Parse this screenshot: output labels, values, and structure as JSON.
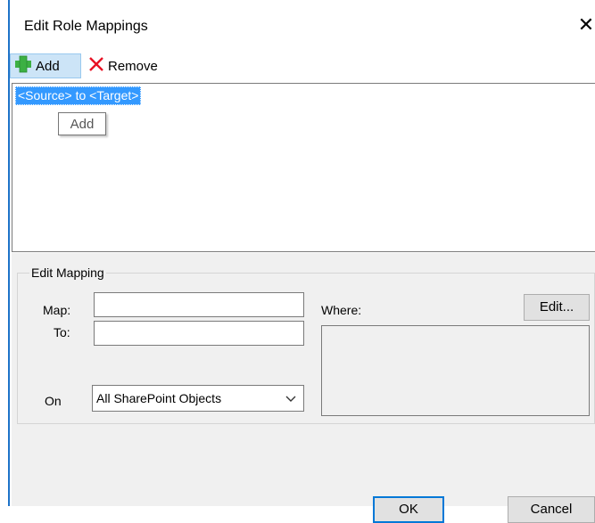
{
  "dialog": {
    "title": "Edit Role Mappings",
    "close_glyph": "✕"
  },
  "toolbar": {
    "add_label": "Add",
    "add_icon": "plus-icon",
    "remove_label": "Remove",
    "remove_icon": "x-icon"
  },
  "list": {
    "items": [
      {
        "label": "<Source> to <Target>",
        "selected": true
      }
    ]
  },
  "tooltip": {
    "text": "Add"
  },
  "edit_mapping": {
    "group_title": "Edit Mapping",
    "map_label": "Map:",
    "map_value": "",
    "to_label": "To:",
    "to_value": "",
    "on_label": "On",
    "on_selected": "All SharePoint Objects",
    "where_label": "Where:",
    "edit_button": "Edit..."
  },
  "footer": {
    "ok_label": "OK",
    "cancel_label": "Cancel"
  },
  "colors": {
    "accent": "#1e73c8",
    "selection": "#3399ff",
    "add_icon": "#3cb043",
    "remove_icon": "#e81123",
    "panel": "#f0f0f0"
  }
}
